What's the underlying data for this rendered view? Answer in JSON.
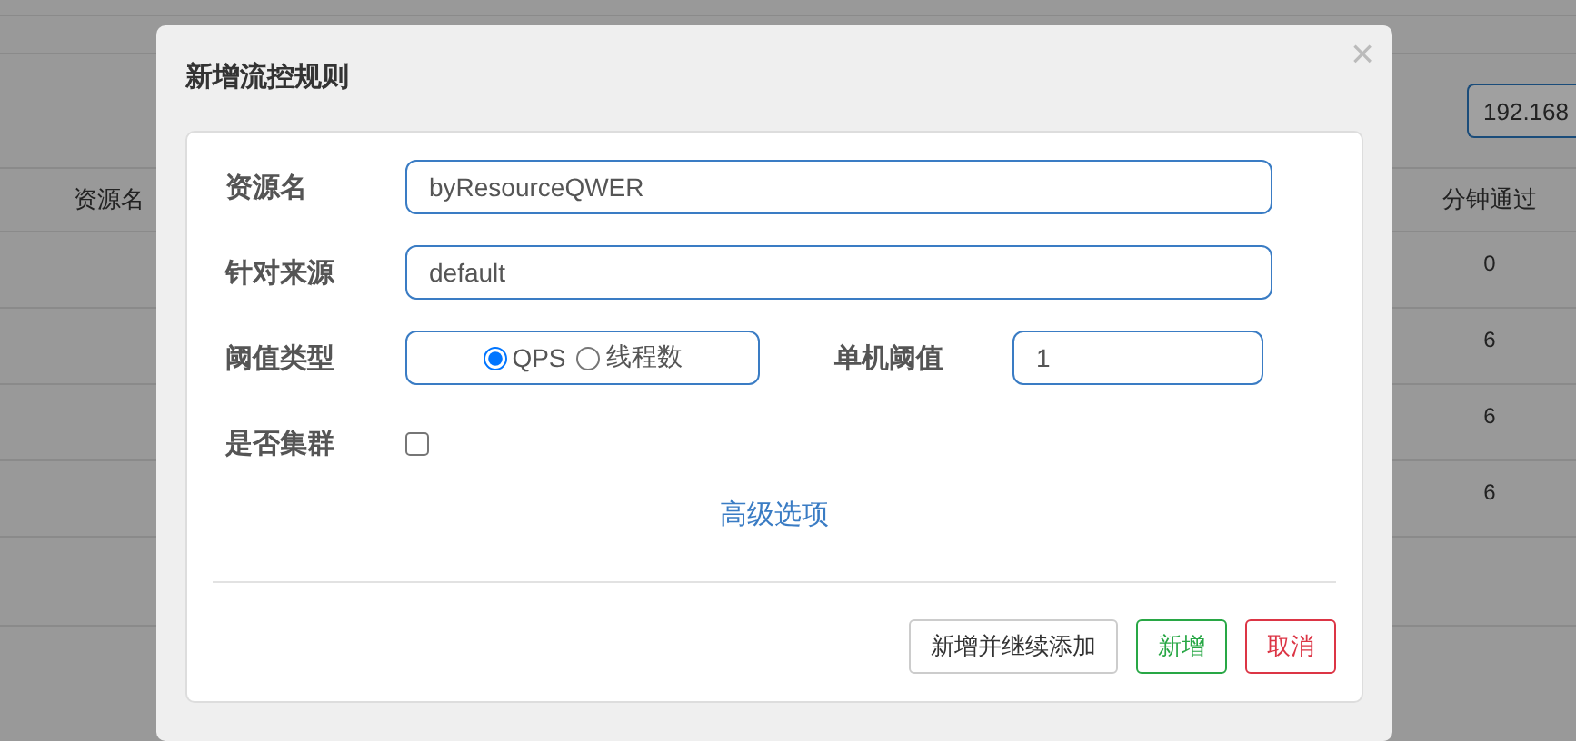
{
  "background_page": {
    "ip_field": {
      "value": "192.168"
    },
    "table": {
      "columns": [
        "资源名",
        "分钟通过"
      ],
      "rows": [
        {
          "cells": [
            "",
            "0"
          ]
        },
        {
          "cells": [
            "",
            "6"
          ]
        },
        {
          "cells": [
            "",
            "6"
          ]
        },
        {
          "cells": [
            "",
            "6"
          ]
        }
      ]
    }
  },
  "dialog": {
    "title": "新增流控规则",
    "close": "×",
    "fields": [
      {
        "kind": "text",
        "label": "资源名",
        "value": "byResourceQWER"
      },
      {
        "kind": "text",
        "label": "针对来源",
        "value": "default"
      },
      {
        "kind": "threshold",
        "label": "阈值类型",
        "options": [
          {
            "label": "QPS",
            "selected": true
          },
          {
            "label": "线程数",
            "selected": false
          }
        ],
        "side_label": "单机阈值",
        "side_value": "1"
      },
      {
        "kind": "checkbox",
        "label": "是否集群",
        "checked": false
      }
    ],
    "advanced_link": "高级选项",
    "buttons": [
      {
        "kind": "default",
        "label": "新增并继续添加"
      },
      {
        "kind": "success",
        "label": "新增"
      },
      {
        "kind": "danger",
        "label": "取消"
      }
    ]
  }
}
